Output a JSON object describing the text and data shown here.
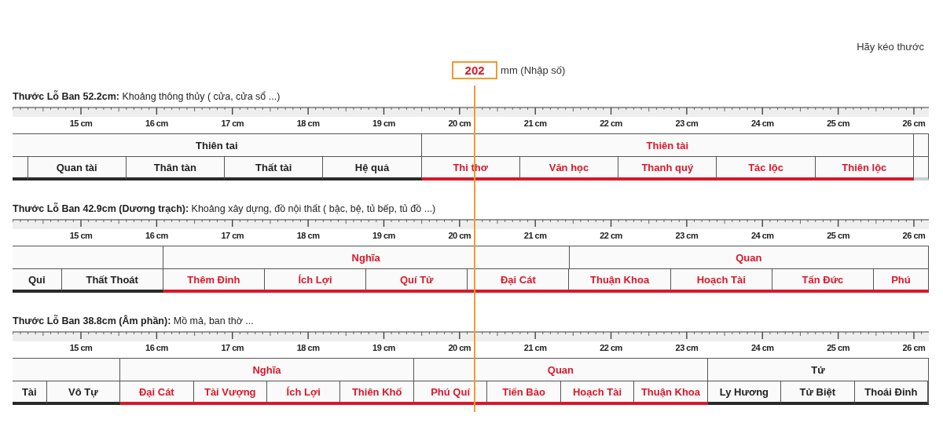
{
  "hint": "Hãy kéo thước",
  "measure": {
    "value": "202",
    "unit_label": "mm (Nhập số)"
  },
  "rulers": [
    {
      "title": "**Thước Lỗ Ban 52.2cm:** Khoảng thông thủy ( cửa, cửa sổ ...)",
      "ticks": [
        "15 cm",
        "16 cm",
        "17 cm",
        "18 cm",
        "19 cm",
        "20 cm",
        "21 cm",
        "22 cm",
        "23 cm",
        "24 cm",
        "25 cm",
        "26 cm"
      ],
      "groups": [
        {
          "label": "Thiên tai",
          "good": false,
          "cells": [
            "Quan tài",
            "Thân tàn",
            "Thất tài",
            "Hệ quả"
          ]
        },
        {
          "label": "Thiên tài",
          "good": true,
          "cells": [
            "Thi thơ",
            "Văn học",
            "Thanh quý",
            "Tác lộc",
            "Thiên lộc"
          ]
        }
      ]
    },
    {
      "title": "**Thước Lỗ Ban 42.9cm (Dương trạch):** Khoảng xây dựng, đồ nội thất ( bậc, bệ, tủ bếp, tủ đồ ...)",
      "ticks": [
        "15 cm",
        "16 cm",
        "17 cm",
        "18 cm",
        "19 cm",
        "20 cm",
        "21 cm",
        "22 cm",
        "23 cm",
        "24 cm",
        "25 cm",
        "26 cm"
      ],
      "groups": [
        {
          "good": false,
          "cells": [
            "Quỉ",
            "Thất Thoát"
          ]
        },
        {
          "label": "Nghĩa",
          "good": true,
          "cells": [
            "Thêm Đinh",
            "Ích Lợi",
            "Quí Tử",
            "Đại Cát"
          ]
        },
        {
          "label": "Quan",
          "good": true,
          "cells": [
            "Thuận Khoa",
            "Hoạch Tài",
            "Tấn Đức",
            "Phú"
          ]
        }
      ]
    },
    {
      "title": "**Thước Lỗ Ban 38.8cm (Âm phần):** Mồ mả, ban thờ ...",
      "ticks": [
        "15 cm",
        "16 cm",
        "17 cm",
        "18 cm",
        "19 cm",
        "20 cm",
        "21 cm",
        "22 cm",
        "23 cm",
        "24 cm",
        "25 cm",
        "26 cm"
      ],
      "groups": [
        {
          "good": false,
          "cells": [
            "Tài",
            "Vô Tự"
          ]
        },
        {
          "label": "Nghĩa",
          "good": true,
          "cells": [
            "Đại Cát",
            "Tài Vượng",
            "Ích Lợi",
            "Thiên Khố"
          ]
        },
        {
          "label": "Quan",
          "good": true,
          "cells": [
            "Phú Quí",
            "Tiến Bảo",
            "Hoạch Tài",
            "Thuận Khoa"
          ]
        },
        {
          "label": "Tử",
          "good": false,
          "cells": [
            "Ly Hương",
            "Tử Biệt",
            "Thoái Đinh"
          ]
        }
      ]
    }
  ]
}
